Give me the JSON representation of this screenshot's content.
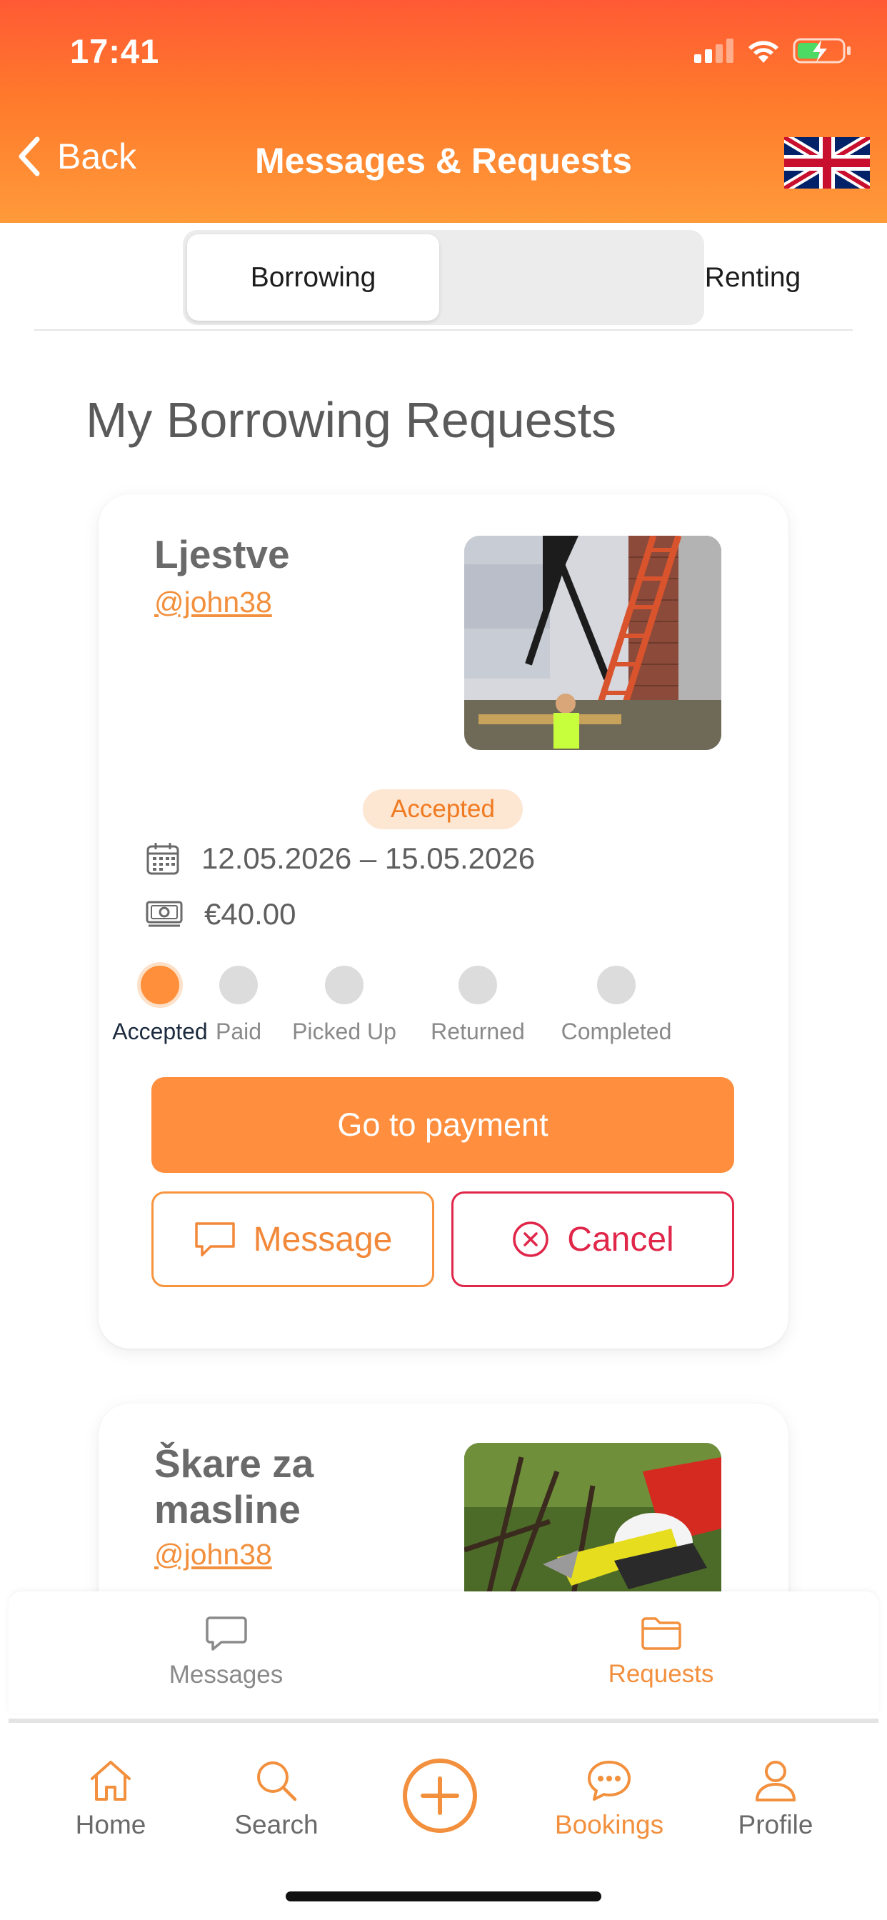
{
  "status_bar": {
    "time": "17:41"
  },
  "header": {
    "back_label": "Back",
    "title": "Messages & Requests"
  },
  "segmented": {
    "borrowing": "Borrowing",
    "renting": "Renting"
  },
  "section_title": "My Borrowing Requests",
  "cards": [
    {
      "name": "Ljestve",
      "owner": "@john38",
      "status": "Accepted",
      "dates": "12.05.2026 – 15.05.2026",
      "price": "€40.00",
      "steps": [
        "Accepted",
        "Paid",
        "Picked Up",
        "Returned",
        "Completed"
      ],
      "current_step": 1,
      "pay_label": "Go to payment",
      "message_label": "Message",
      "cancel_label": "Cancel"
    },
    {
      "name": "Škare za masline",
      "owner": "@john38"
    }
  ],
  "subtabs": {
    "messages": "Messages",
    "requests": "Requests",
    "active": "requests"
  },
  "bottom_nav": {
    "home": "Home",
    "search": "Search",
    "add_icon": "plus-circle-icon",
    "bookings": "Bookings",
    "profile": "Profile",
    "active": "bookings"
  },
  "colors": {
    "accent": "#ff8f3e",
    "header_top": "#ff5a34",
    "header_bottom": "#ff9a3a",
    "danger": "#e0274a",
    "badge_bg": "#fde6d2"
  }
}
